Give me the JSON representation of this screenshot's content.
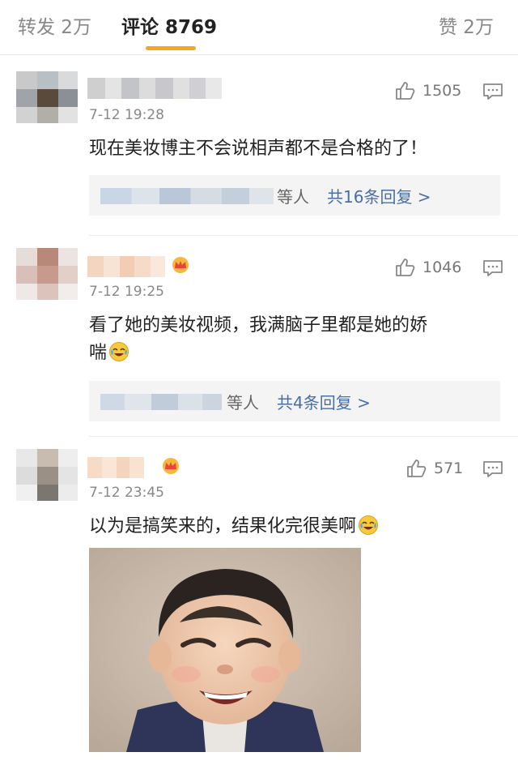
{
  "tabs": {
    "repost": "转发 2万",
    "comments": "评论 8769",
    "likes": "赞 2万"
  },
  "comments": [
    {
      "time": "7-12 19:28",
      "text": "现在美妆博主不会说相声都不是合格的了！",
      "likes": "1505",
      "replies_etc": "等人",
      "replies_count": "共16条回复 >"
    },
    {
      "time": "7-12 19:25",
      "text_line1": "看了她的美妆视频，我满脑子里都是她的娇",
      "text_line2": "喘",
      "likes": "1046",
      "replies_etc": "等人",
      "replies_count": "共4条回复 >"
    },
    {
      "time": "7-12 23:45",
      "text": "以为是搞笑来的，结果化完很美啊",
      "likes": "571"
    }
  ],
  "icons": {
    "like": "thumbs-up-icon",
    "reply": "comment-bubble-icon",
    "emoji": "laugh-cry-emoji-icon",
    "badge": "crown-badge-icon"
  },
  "colors": {
    "accent_underline": "#f5a623",
    "reply_count_link": "#4a6ea8"
  }
}
